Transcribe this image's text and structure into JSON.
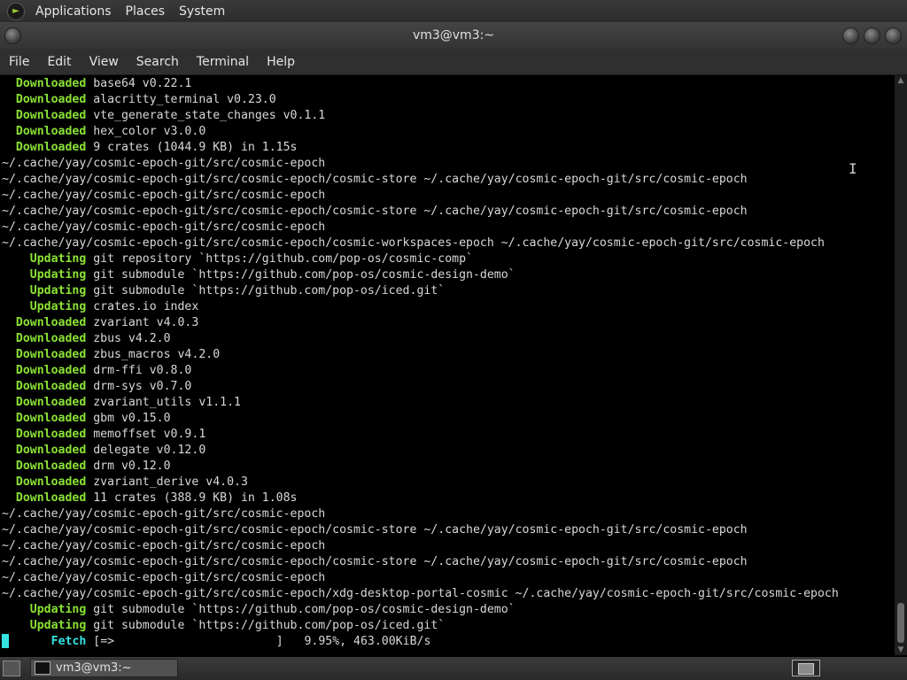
{
  "top_panel": {
    "items": [
      "Applications",
      "Places",
      "System"
    ]
  },
  "window": {
    "title": "vm3@vm3:~"
  },
  "menubar": {
    "items": [
      "File",
      "Edit",
      "View",
      "Search",
      "Terminal",
      "Help"
    ]
  },
  "terminal": {
    "lines": [
      {
        "prefix": "  Downloaded",
        "text": " base64 v0.22.1"
      },
      {
        "prefix": "  Downloaded",
        "text": " alacritty_terminal v0.23.0"
      },
      {
        "prefix": "  Downloaded",
        "text": " vte_generate_state_changes v0.1.1"
      },
      {
        "prefix": "  Downloaded",
        "text": " hex_color v3.0.0"
      },
      {
        "prefix": "  Downloaded",
        "text": " 9 crates (1044.9 KB) in 1.15s"
      },
      {
        "prefix": "",
        "text": "~/.cache/yay/cosmic-epoch-git/src/cosmic-epoch"
      },
      {
        "prefix": "",
        "text": "~/.cache/yay/cosmic-epoch-git/src/cosmic-epoch/cosmic-store ~/.cache/yay/cosmic-epoch-git/src/cosmic-epoch"
      },
      {
        "prefix": "",
        "text": "~/.cache/yay/cosmic-epoch-git/src/cosmic-epoch"
      },
      {
        "prefix": "",
        "text": "~/.cache/yay/cosmic-epoch-git/src/cosmic-epoch/cosmic-store ~/.cache/yay/cosmic-epoch-git/src/cosmic-epoch"
      },
      {
        "prefix": "",
        "text": "~/.cache/yay/cosmic-epoch-git/src/cosmic-epoch"
      },
      {
        "prefix": "",
        "text": "~/.cache/yay/cosmic-epoch-git/src/cosmic-epoch/cosmic-workspaces-epoch ~/.cache/yay/cosmic-epoch-git/src/cosmic-epoch"
      },
      {
        "prefix": "    Updating",
        "text": " git repository `https://github.com/pop-os/cosmic-comp`"
      },
      {
        "prefix": "    Updating",
        "text": " git submodule `https://github.com/pop-os/cosmic-design-demo`"
      },
      {
        "prefix": "    Updating",
        "text": " git submodule `https://github.com/pop-os/iced.git`"
      },
      {
        "prefix": "    Updating",
        "text": " crates.io index"
      },
      {
        "prefix": "  Downloaded",
        "text": " zvariant v4.0.3"
      },
      {
        "prefix": "  Downloaded",
        "text": " zbus v4.2.0"
      },
      {
        "prefix": "  Downloaded",
        "text": " zbus_macros v4.2.0"
      },
      {
        "prefix": "  Downloaded",
        "text": " drm-ffi v0.8.0"
      },
      {
        "prefix": "  Downloaded",
        "text": " drm-sys v0.7.0"
      },
      {
        "prefix": "  Downloaded",
        "text": " zvariant_utils v1.1.1"
      },
      {
        "prefix": "  Downloaded",
        "text": " gbm v0.15.0"
      },
      {
        "prefix": "  Downloaded",
        "text": " memoffset v0.9.1"
      },
      {
        "prefix": "  Downloaded",
        "text": " delegate v0.12.0"
      },
      {
        "prefix": "  Downloaded",
        "text": " drm v0.12.0"
      },
      {
        "prefix": "  Downloaded",
        "text": " zvariant_derive v4.0.3"
      },
      {
        "prefix": "  Downloaded",
        "text": " 11 crates (388.9 KB) in 1.08s"
      },
      {
        "prefix": "",
        "text": "~/.cache/yay/cosmic-epoch-git/src/cosmic-epoch"
      },
      {
        "prefix": "",
        "text": "~/.cache/yay/cosmic-epoch-git/src/cosmic-epoch/cosmic-store ~/.cache/yay/cosmic-epoch-git/src/cosmic-epoch"
      },
      {
        "prefix": "",
        "text": "~/.cache/yay/cosmic-epoch-git/src/cosmic-epoch"
      },
      {
        "prefix": "",
        "text": "~/.cache/yay/cosmic-epoch-git/src/cosmic-epoch/cosmic-store ~/.cache/yay/cosmic-epoch-git/src/cosmic-epoch"
      },
      {
        "prefix": "",
        "text": "~/.cache/yay/cosmic-epoch-git/src/cosmic-epoch"
      },
      {
        "prefix": "",
        "text": "~/.cache/yay/cosmic-epoch-git/src/cosmic-epoch/xdg-desktop-portal-cosmic ~/.cache/yay/cosmic-epoch-git/src/cosmic-epoch"
      },
      {
        "prefix": "    Updating",
        "text": " git submodule `https://github.com/pop-os/cosmic-design-demo`"
      },
      {
        "prefix": "    Updating",
        "text": " git submodule `https://github.com/pop-os/iced.git`"
      }
    ],
    "fetch_line": {
      "prefix": "      Fetch",
      "text": " [=>                       ]   9.95%, 463.00KiB/s"
    }
  },
  "taskbar": {
    "items": [
      {
        "label": "vm3@vm3:~"
      }
    ]
  },
  "colors": {
    "downloaded": "#8ae234",
    "fetch": "#34e2e2",
    "text": "#d8d8d8",
    "background": "#000000"
  },
  "icons": {
    "app_menu": "terminal-launcher-icon",
    "taskbar": "terminal-icon",
    "show_desktop": "show-desktop-icon",
    "workspace": "workspace-switcher-icon"
  }
}
